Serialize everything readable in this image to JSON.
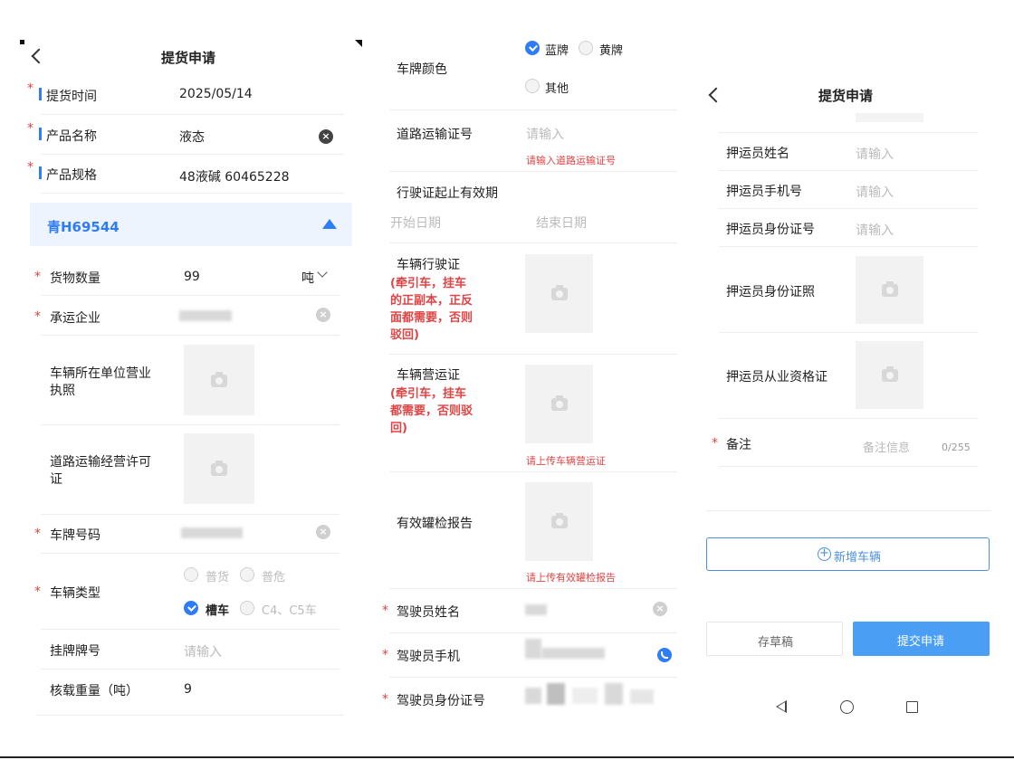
{
  "header": {
    "title": "提货申请"
  },
  "panel1": {
    "pickup_time": {
      "label": "提货时间",
      "value": "2025/05/14"
    },
    "product_name": {
      "label": "产品名称",
      "value": "液态"
    },
    "product_spec": {
      "label": "产品规格",
      "value": "48液碱 60465228"
    },
    "vehicle_section": {
      "plate": "青H69544"
    },
    "cargo_qty": {
      "label": "货物数量",
      "value": "99",
      "unit": "吨"
    },
    "carrier": {
      "label": "承运企业"
    },
    "business_license": {
      "label_line1": "车辆所在单位营业",
      "label_line2": "执照"
    },
    "transport_permit": {
      "label_line1": "道路运输经营许可",
      "label_line2": "证"
    },
    "plate_number": {
      "label": "车牌号码"
    },
    "vehicle_type": {
      "label": "车辆类型",
      "options": [
        "普货",
        "普危",
        "槽车",
        "C4、C5车"
      ],
      "selected": "槽车"
    },
    "trailer_plate": {
      "label": "挂牌牌号",
      "placeholder": "请输入"
    },
    "load_weight": {
      "label": "核载重量（吨）",
      "value": "9"
    }
  },
  "panel2": {
    "plate_color": {
      "label": "车牌颜色",
      "options": [
        "蓝牌",
        "黄牌",
        "其他"
      ],
      "selected": "蓝牌"
    },
    "road_cert": {
      "label": "道路运输证号",
      "placeholder": "请输入",
      "error": "请输入道路运输证号"
    },
    "license_validity": {
      "label": "行驶证起止有效期",
      "start_placeholder": "开始日期",
      "end_placeholder": "结束日期"
    },
    "driving_license": {
      "label": "车辆行驶证",
      "note_lines": [
        "(牵引车，挂车",
        "的正副本，正反",
        "面都需要，否则",
        "驳回)"
      ]
    },
    "operating_license": {
      "label": "车辆营运证",
      "note_lines": [
        "(牵引车，挂车",
        "都需要，否则驳",
        "回)"
      ],
      "error": "请上传车辆营运证"
    },
    "tank_report": {
      "label": "有效罐检报告",
      "error": "请上传有效罐检报告"
    },
    "driver_name": {
      "label": "驾驶员姓名"
    },
    "driver_phone": {
      "label": "驾驶员手机"
    },
    "driver_id": {
      "label": "驾驶员身份证号"
    }
  },
  "panel3": {
    "escort_name": {
      "label": "押运员姓名",
      "placeholder": "请输入"
    },
    "escort_phone": {
      "label": "押运员手机号",
      "placeholder": "请输入"
    },
    "escort_id": {
      "label": "押运员身份证号",
      "placeholder": "请输入"
    },
    "escort_id_photo": {
      "label": "押运员身份证照"
    },
    "escort_cert": {
      "label": "押运员从业资格证"
    },
    "remark": {
      "label": "备注",
      "placeholder": "备注信息",
      "counter": "0/255"
    },
    "add_vehicle": {
      "label": "新增车辆"
    },
    "save_draft": {
      "label": "存草稿"
    },
    "submit": {
      "label": "提交申请"
    }
  },
  "colors": {
    "accent": "#2f7df6",
    "error": "#e04444",
    "primary_button": "#4a9ff5",
    "section_bg": "#eef4fd"
  },
  "icons": [
    "back-icon",
    "clear-icon",
    "triangle-up-icon",
    "chevron-down-icon",
    "camera-icon",
    "phone-icon",
    "plus-circle-icon",
    "nav-back-icon",
    "nav-home-icon",
    "nav-recent-icon",
    "check-icon"
  ]
}
